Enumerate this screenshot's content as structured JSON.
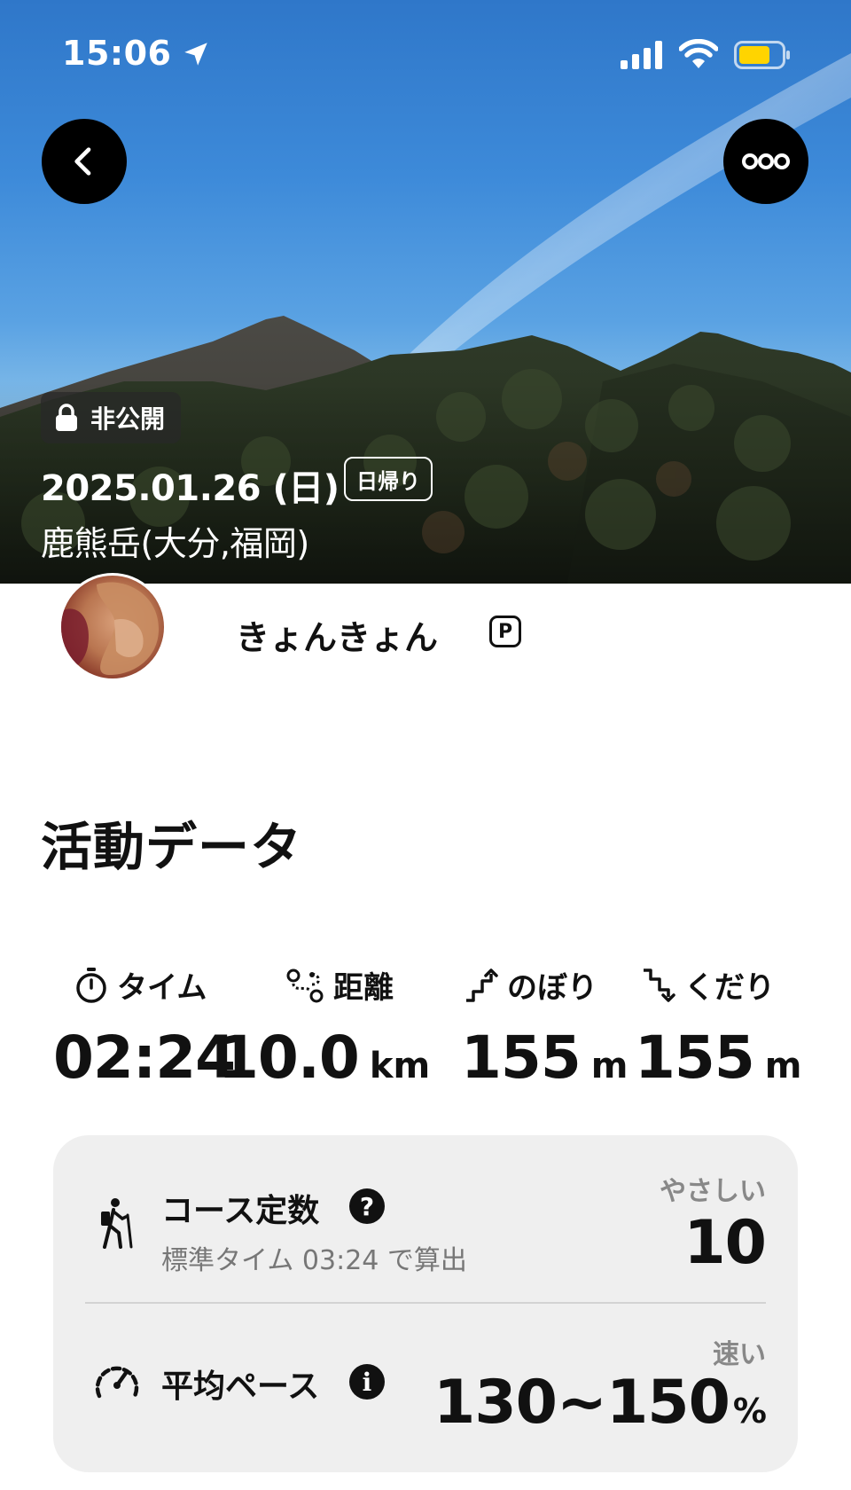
{
  "status_bar": {
    "time": "15:06"
  },
  "header": {
    "visibility": "非公開",
    "date": "2025.01.26 (日)",
    "trip_type": "日帰り",
    "mountain": "鹿熊岳(大分,福岡)"
  },
  "profile": {
    "username": "きょんきょん",
    "badge": "P"
  },
  "section_title": "活動データ",
  "stats": [
    {
      "label": "タイム",
      "icon": "stopwatch-icon",
      "value": "02:24",
      "unit": ""
    },
    {
      "label": "距離",
      "icon": "route-icon",
      "value": "10.0",
      "unit": "km"
    },
    {
      "label": "のぼり",
      "icon": "ascent-icon",
      "value": "155",
      "unit": "m"
    },
    {
      "label": "くだり",
      "icon": "descent-icon",
      "value": "155",
      "unit": "m"
    }
  ],
  "course": {
    "title": "コース定数",
    "help": "?",
    "subtitle": "標準タイム 03:24 で算出",
    "tag": "やさしい",
    "value": "10",
    "icon": "hiker-icon"
  },
  "pace": {
    "title": "平均ペース",
    "help": "i",
    "tag": "速い",
    "value": "130~150",
    "unit": "%",
    "icon": "speedometer-icon"
  }
}
